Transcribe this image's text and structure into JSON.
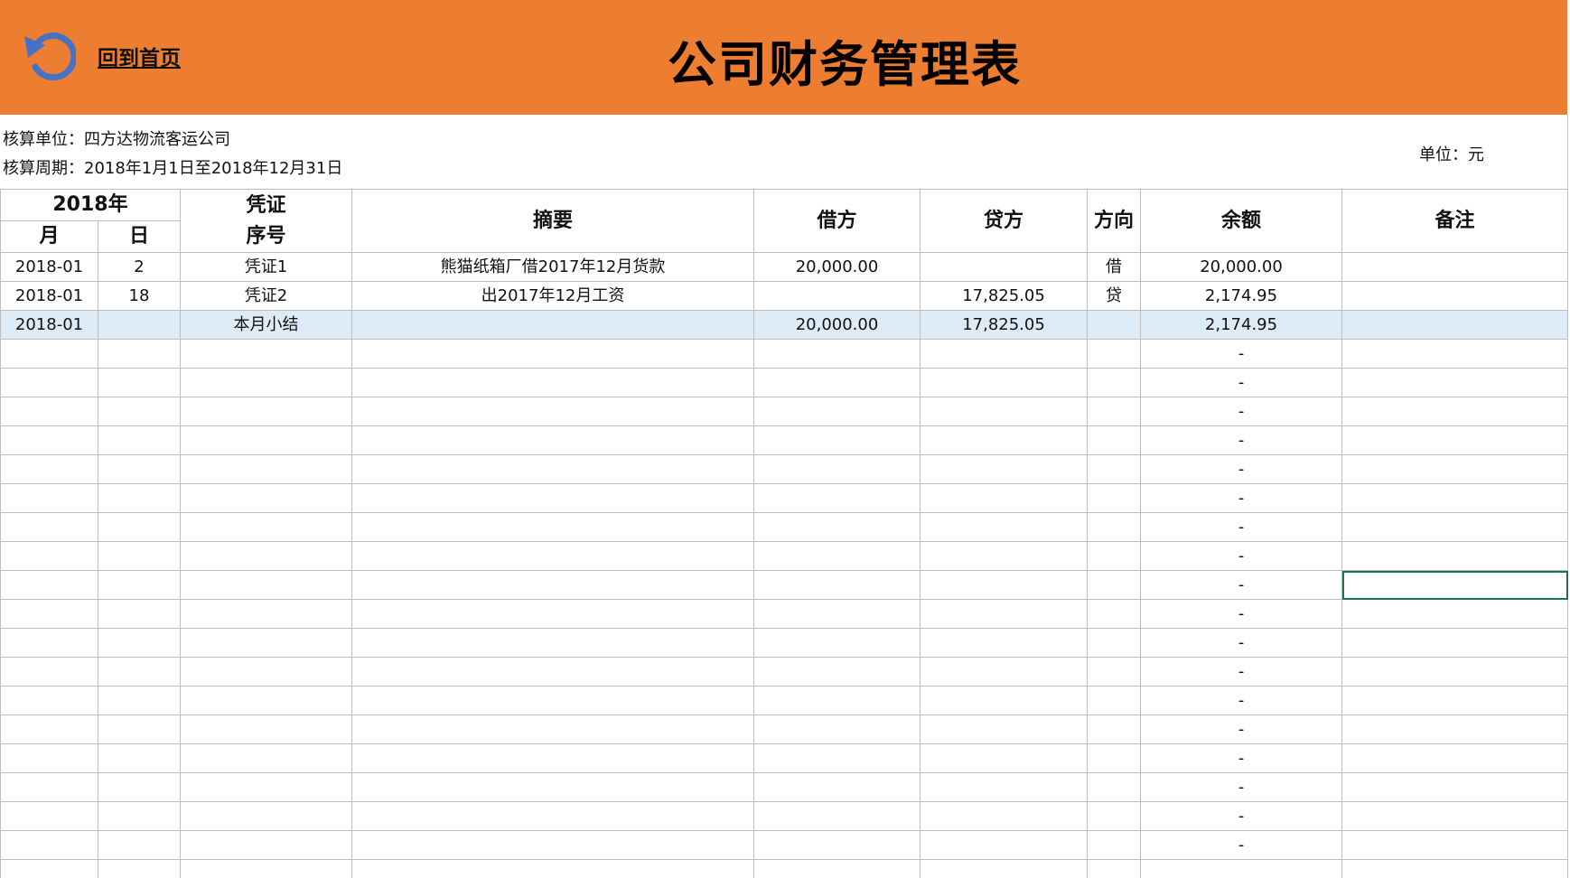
{
  "header": {
    "back_label": "回到首页",
    "title": "公司财务管理表"
  },
  "info": {
    "unit_line": "核算单位：四方达物流客运公司",
    "period_line": "核算周期：2018年1月1日至2018年12月31日",
    "currency_line": "单位：元"
  },
  "table": {
    "year_header": "2018年",
    "month_header": "月",
    "day_header": "日",
    "voucher_header_1": "凭证",
    "voucher_header_2": "序号",
    "summary_header": "摘要",
    "debit_header": "借方",
    "credit_header": "贷方",
    "direction_header": "方向",
    "balance_header": "余额",
    "remark_header": "备注",
    "rows": [
      {
        "month": "2018-01",
        "day": "2",
        "voucher": "凭证1",
        "summary": "熊猫纸箱厂借2017年12月货款",
        "debit": "20,000.00",
        "credit": "",
        "direction": "借",
        "balance": "20,000.00",
        "remark": ""
      },
      {
        "month": "2018-01",
        "day": "18",
        "voucher": "凭证2",
        "summary": "出2017年12月工资",
        "debit": "",
        "credit": "17,825.05",
        "direction": "贷",
        "balance": "2,174.95",
        "remark": ""
      },
      {
        "month": "2018-01",
        "day": "",
        "voucher": "本月小结",
        "summary": "",
        "debit": "20,000.00",
        "credit": "17,825.05",
        "direction": "",
        "balance": "2,174.95",
        "remark": ""
      }
    ],
    "empty_balance": "-",
    "empty_row_count": 18,
    "selected_empty_row": 8,
    "subtotal_fill": "#DDEBF7"
  },
  "colors": {
    "banner": "#ED7D31",
    "back_icon": "#4472C4",
    "selection": "#217346"
  },
  "icons": {
    "back": "undo-arrow-icon"
  }
}
